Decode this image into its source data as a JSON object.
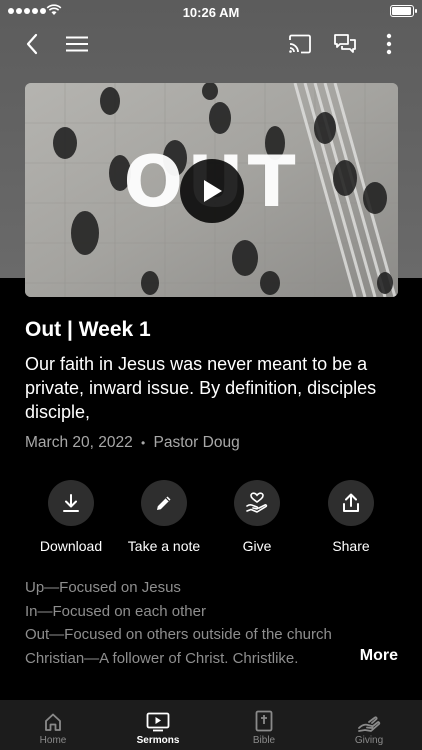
{
  "status_bar": {
    "time": "10:26 AM"
  },
  "video": {
    "overlay_title": "OUT"
  },
  "sermon": {
    "title": "Out | Week 1",
    "description": "Our faith in Jesus was never meant to be a private, inward issue. By definition, disciples disciple,",
    "date": "March 20, 2022",
    "separator": "•",
    "speaker": "Pastor Doug"
  },
  "actions": [
    {
      "label": "Download",
      "icon": "download-icon"
    },
    {
      "label": "Take a note",
      "icon": "pencil-icon"
    },
    {
      "label": "Give",
      "icon": "give-icon"
    },
    {
      "label": "Share",
      "icon": "share-icon"
    }
  ],
  "notes": [
    "Up—Focused on Jesus",
    "In—Focused on each other",
    "Out—Focused on others outside of the church",
    "Christian—A follower of Christ.  Christlike."
  ],
  "more_label": "More",
  "tabs": [
    {
      "label": "Home",
      "icon": "home-icon",
      "active": false
    },
    {
      "label": "Sermons",
      "icon": "sermons-icon",
      "active": true
    },
    {
      "label": "Bible",
      "icon": "bible-icon",
      "active": false
    },
    {
      "label": "Giving",
      "icon": "giving-icon",
      "active": false
    }
  ],
  "colors": {
    "background": "#000000",
    "header_gray": "#636363",
    "tabbar": "#1c1c1c",
    "muted_text": "#a8a8a8"
  }
}
